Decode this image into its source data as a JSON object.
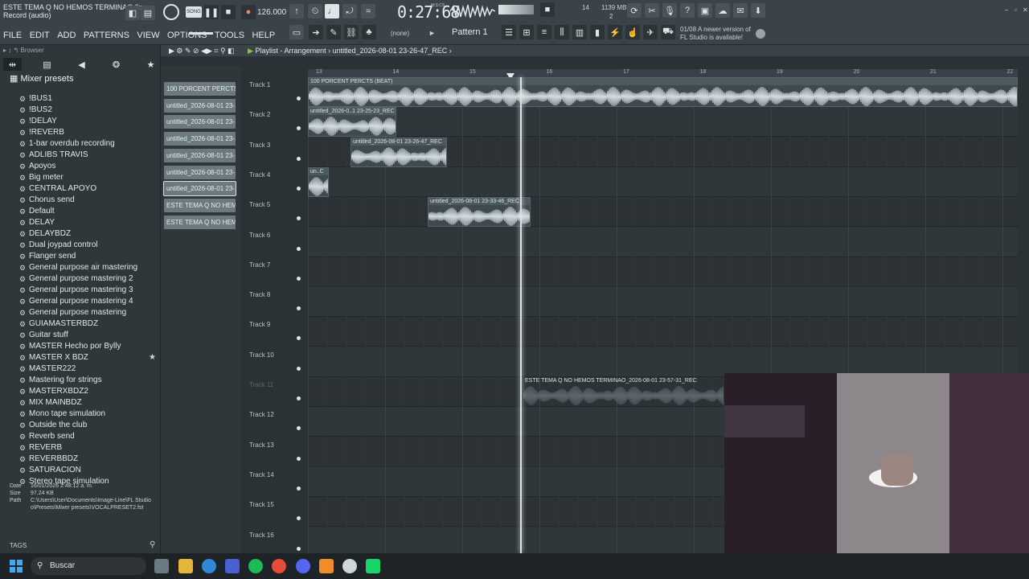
{
  "window": {
    "project_title": "ESTE TEMA Q NO HEMOS TERMINAO.flp",
    "mode": "Record (audio)"
  },
  "menu": [
    "FILE",
    "EDIT",
    "ADD",
    "PATTERNS",
    "VIEW",
    "OPTIONS",
    "TOOLS",
    "HELP"
  ],
  "transport": {
    "tempo": "126.000",
    "song_label": "SONG",
    "time_display": "0:27:68",
    "time_label": "M:S:CS",
    "cpu": "14",
    "memory": "1139 MB",
    "voices": "2",
    "pattern": "Pattern 1",
    "none_label": "(none)"
  },
  "update_notice": {
    "date": "01/08",
    "text_1": "A newer version of",
    "text_2": "FL Studio is available!"
  },
  "browser": {
    "header": "Browser",
    "folder": "Mixer presets",
    "presets": [
      "!BUS1",
      "!BUS2",
      "!DELAY",
      "!REVERB",
      "1-bar overdub recording",
      "ADLIBS TRAVIS",
      "Apoyos",
      "Big meter",
      "CENTRAL APOYO",
      "Chorus send",
      "Default",
      "DELAY",
      "DELAYBDZ",
      "Dual joypad control",
      "Flanger send",
      "General purpose air mastering",
      "General purpose mastering 2",
      "General purpose mastering 3",
      "General purpose mastering 4",
      "General purpose mastering",
      "GUIAMASTERBDZ",
      "Guitar stuff",
      "MASTER Hecho por Bylly",
      "MASTER X BDZ",
      "MASTER222",
      "Mastering for strings",
      "MASTERXBDZ2",
      "MIX MAINBDZ",
      "Mono tape simulation",
      "Outside the club",
      "Reverb send",
      "REVERB",
      "REVERBBDZ",
      "SATURACION",
      "Stereo tape simulation"
    ],
    "file_info": {
      "date_label": "Date",
      "date": "16/01/2026 2:48:12 a. m.",
      "size_label": "Size",
      "size": "97.24 KB",
      "path_label": "Path",
      "path_1": "C:\\Users\\User\\Documents\\Image-Line\\FL Studio",
      "path_2": "o\\Presets\\Mixer presets\\VOCALPRESET2.fst"
    },
    "tags_label": "TAGS"
  },
  "playlist": {
    "title": "Playlist - Arrangement",
    "current_clip": "untitled_2026-08-01 23-26-47_REC",
    "ruler": [
      "13",
      "14",
      "15",
      "16",
      "17",
      "18",
      "19",
      "20",
      "21",
      "22"
    ],
    "pattern_clips": [
      "100 PORCENT PERCTS...",
      "untitled_2026-08-01 23-...",
      "untitled_2026-08-01 23-...",
      "untitled_2026-08-01 23-...",
      "untitled_2026-08-01 23-...",
      "untitled_2026-08-01 23-...",
      "untitled_2026-08-01 23-...",
      "ESTE TEMA Q NO HEMOS T...",
      "ESTE TEMA Q NO HEMOS T..."
    ],
    "tracks": [
      "Track 1",
      "Track 2",
      "Track 3",
      "Track 4",
      "Track 5",
      "Track 6",
      "Track 7",
      "Track 8",
      "Track 9",
      "Track 10",
      "Track 11",
      "Track 12",
      "Track 13",
      "Track 14",
      "Track 15",
      "Track 16"
    ],
    "clips": [
      {
        "label": "100 PORCENT PERCTS (BEAT)"
      },
      {
        "label": "untitled_2026-0..1 23-25-23_REC"
      },
      {
        "label": "untitled_2026-08-01 23-26-47_REC"
      },
      {
        "label": "un..C"
      },
      {
        "label": "untitled_2026-08-01 23-33-46_REC"
      },
      {
        "label": "ESTE TEMA Q NO HEMOS TERMINAO_2026-08-01 23-57-31_REC"
      }
    ]
  },
  "taskbar": {
    "search_placeholder": "Buscar"
  },
  "colors": {
    "background": "#2b3236",
    "toolbar": "#3a4347",
    "clip": "#6c7a7f",
    "waveform": "#d3dcdf"
  }
}
